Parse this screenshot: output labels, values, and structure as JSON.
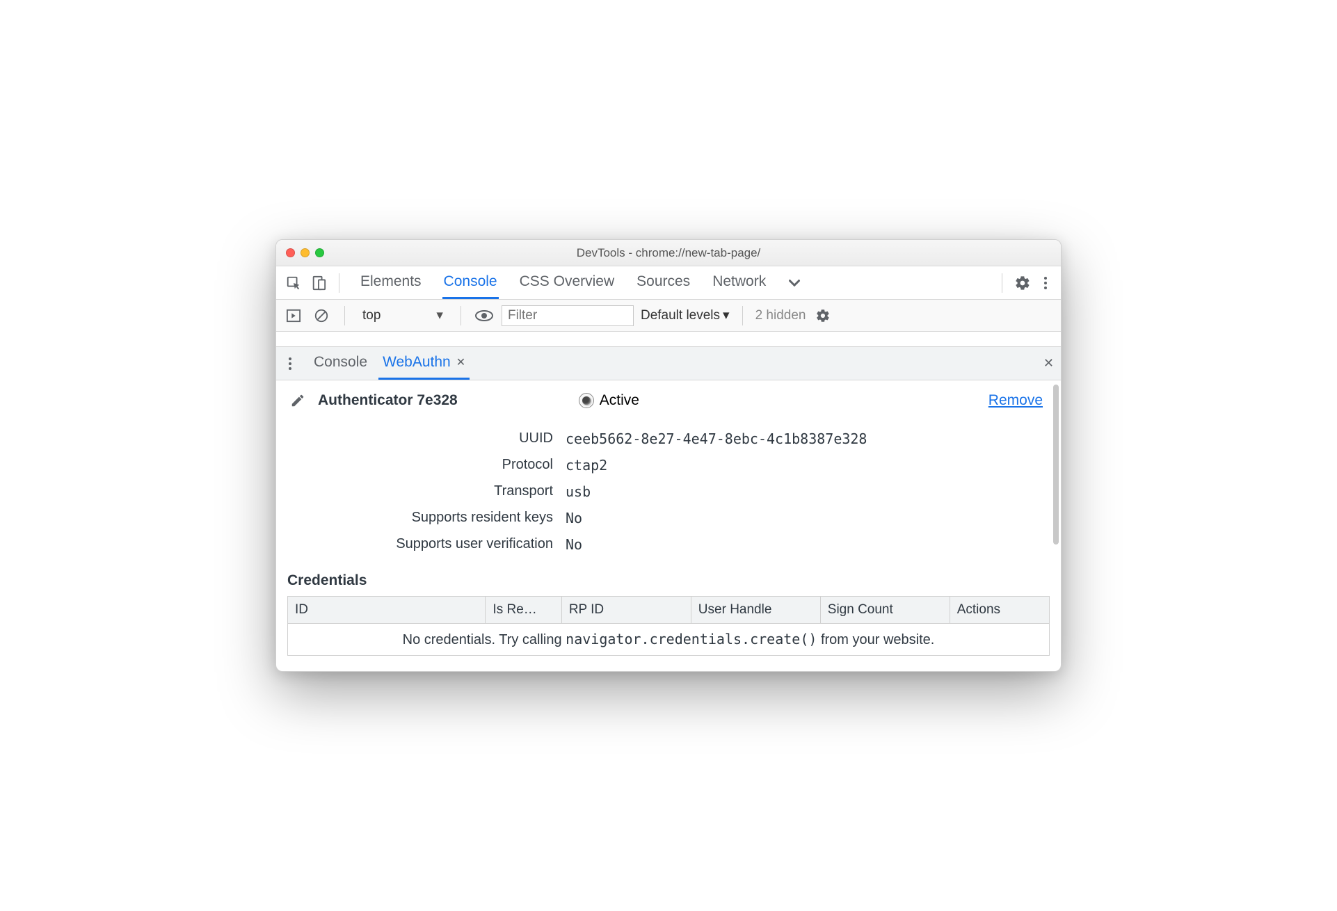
{
  "window": {
    "title": "DevTools - chrome://new-tab-page/"
  },
  "main_tabs": {
    "items": [
      "Elements",
      "Console",
      "CSS Overview",
      "Sources",
      "Network"
    ],
    "active_index": 1
  },
  "console_toolbar": {
    "context": "top",
    "filter_placeholder": "Filter",
    "levels_label": "Default levels",
    "hidden_label": "2 hidden"
  },
  "drawer": {
    "tabs": [
      "Console",
      "WebAuthn"
    ],
    "active_index": 1
  },
  "authenticator": {
    "name": "Authenticator 7e328",
    "active_label": "Active",
    "remove_label": "Remove",
    "fields": {
      "uuid_label": "UUID",
      "uuid_value": "ceeb5662-8e27-4e47-8ebc-4c1b8387e328",
      "protocol_label": "Protocol",
      "protocol_value": "ctap2",
      "transport_label": "Transport",
      "transport_value": "usb",
      "resident_label": "Supports resident keys",
      "resident_value": "No",
      "uv_label": "Supports user verification",
      "uv_value": "No"
    }
  },
  "credentials": {
    "heading": "Credentials",
    "columns": {
      "id": "ID",
      "is_resident": "Is Re…",
      "rp_id": "RP ID",
      "user_handle": "User Handle",
      "sign_count": "Sign Count",
      "actions": "Actions"
    },
    "empty_prefix": "No credentials. Try calling ",
    "empty_code": "navigator.credentials.create()",
    "empty_suffix": " from your website."
  }
}
